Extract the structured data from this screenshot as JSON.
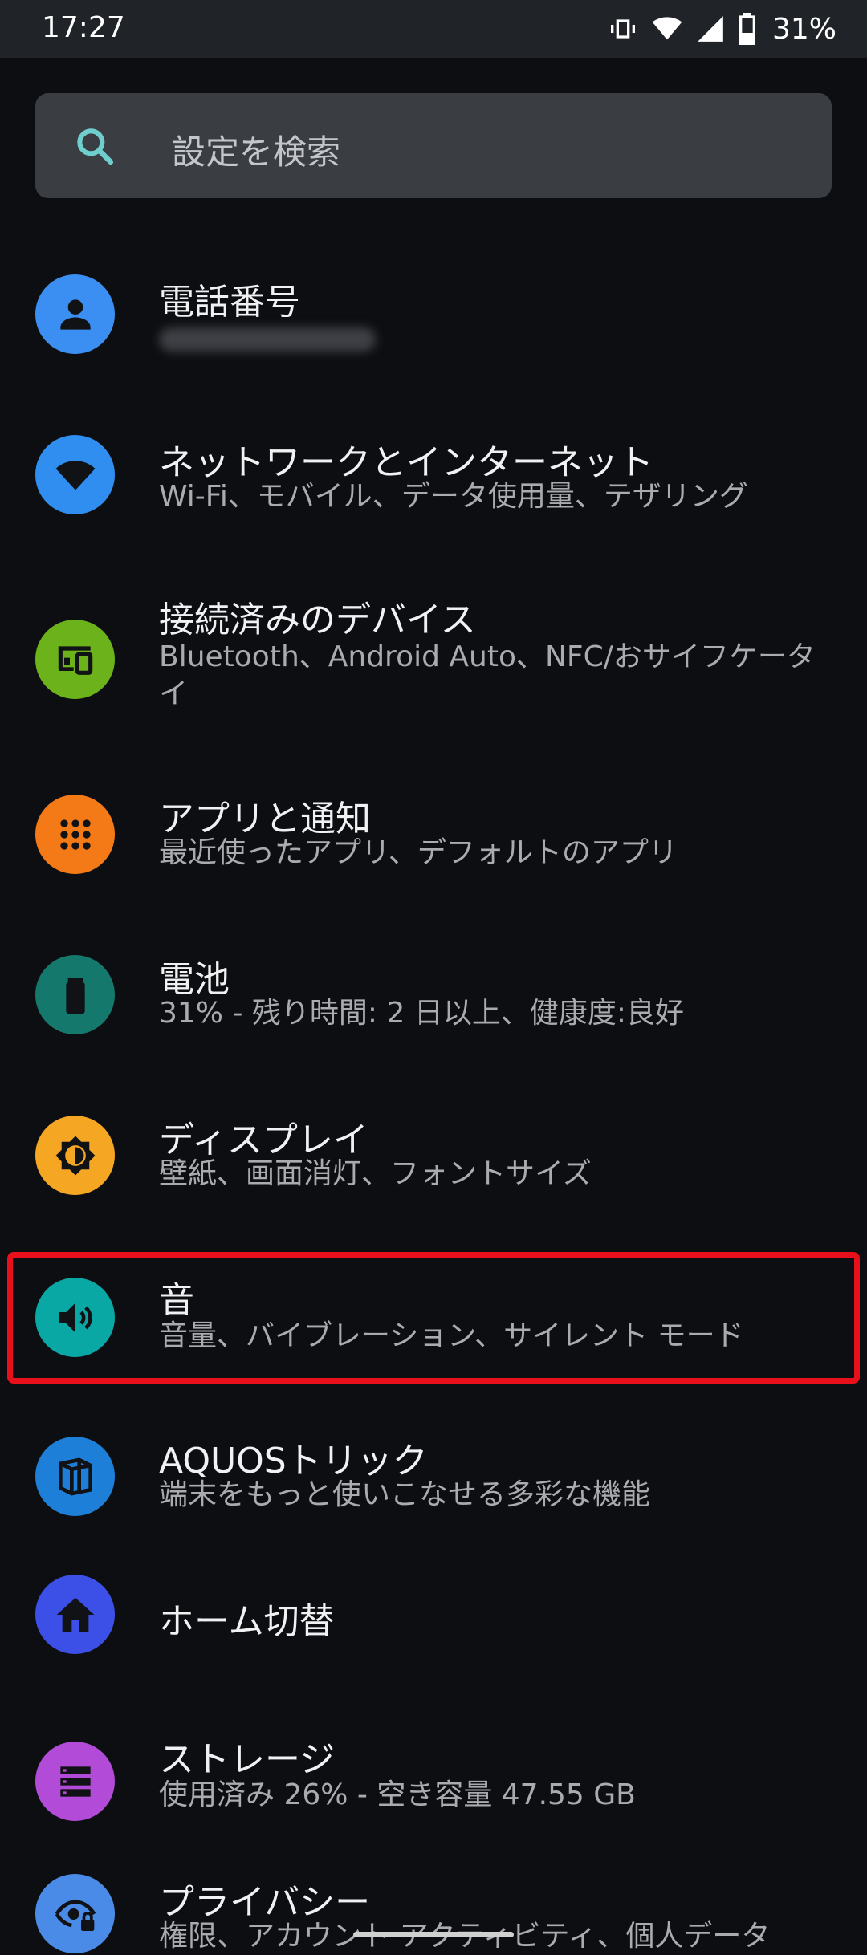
{
  "status_bar": {
    "time": "17:27",
    "battery_percent": "31%"
  },
  "search": {
    "placeholder": "設定を検索"
  },
  "items": [
    {
      "title": "電話番号",
      "subtitle": "",
      "color": "#3b8ff2",
      "icon": "person-icon"
    },
    {
      "title": "ネットワークとインターネット",
      "subtitle": "Wi-Fi、モバイル、データ使用量、テザリング",
      "color": "#2f8ef0",
      "icon": "wifi-icon"
    },
    {
      "title": "接続済みのデバイス",
      "subtitle": "Bluetooth、Android Auto、NFC/おサイフケータイ",
      "color": "#6cb21a",
      "icon": "devices-icon"
    },
    {
      "title": "アプリと通知",
      "subtitle": "最近使ったアプリ、デフォルトのアプリ",
      "color": "#f47a17",
      "icon": "apps-icon"
    },
    {
      "title": "電池",
      "subtitle": "31% - 残り時間: 2 日以上、健康度:良好",
      "color": "#14796c",
      "icon": "battery-icon"
    },
    {
      "title": "ディスプレイ",
      "subtitle": "壁紙、画面消灯、フォントサイズ",
      "color": "#f5a623",
      "icon": "brightness-icon"
    },
    {
      "title": "音",
      "subtitle": "音量、バイブレーション、サイレント モード",
      "color": "#0aa8a5",
      "icon": "volume-icon"
    },
    {
      "title": "AQUOSトリック",
      "subtitle": "端末をもっと使いこなせる多彩な機能",
      "color": "#1e7fd8",
      "icon": "aquos-trick-icon"
    },
    {
      "title": "ホーム切替",
      "subtitle": "",
      "color": "#3c4fe6",
      "icon": "home-icon"
    },
    {
      "title": "ストレージ",
      "subtitle": "使用済み 26% - 空き容量 47.55 GB",
      "color": "#b14bd8",
      "icon": "storage-icon"
    },
    {
      "title": "プライバシー",
      "subtitle": "権限、アカウント アクティビティ、個人データ",
      "color": "#4a8be8",
      "icon": "privacy-icon"
    }
  ]
}
